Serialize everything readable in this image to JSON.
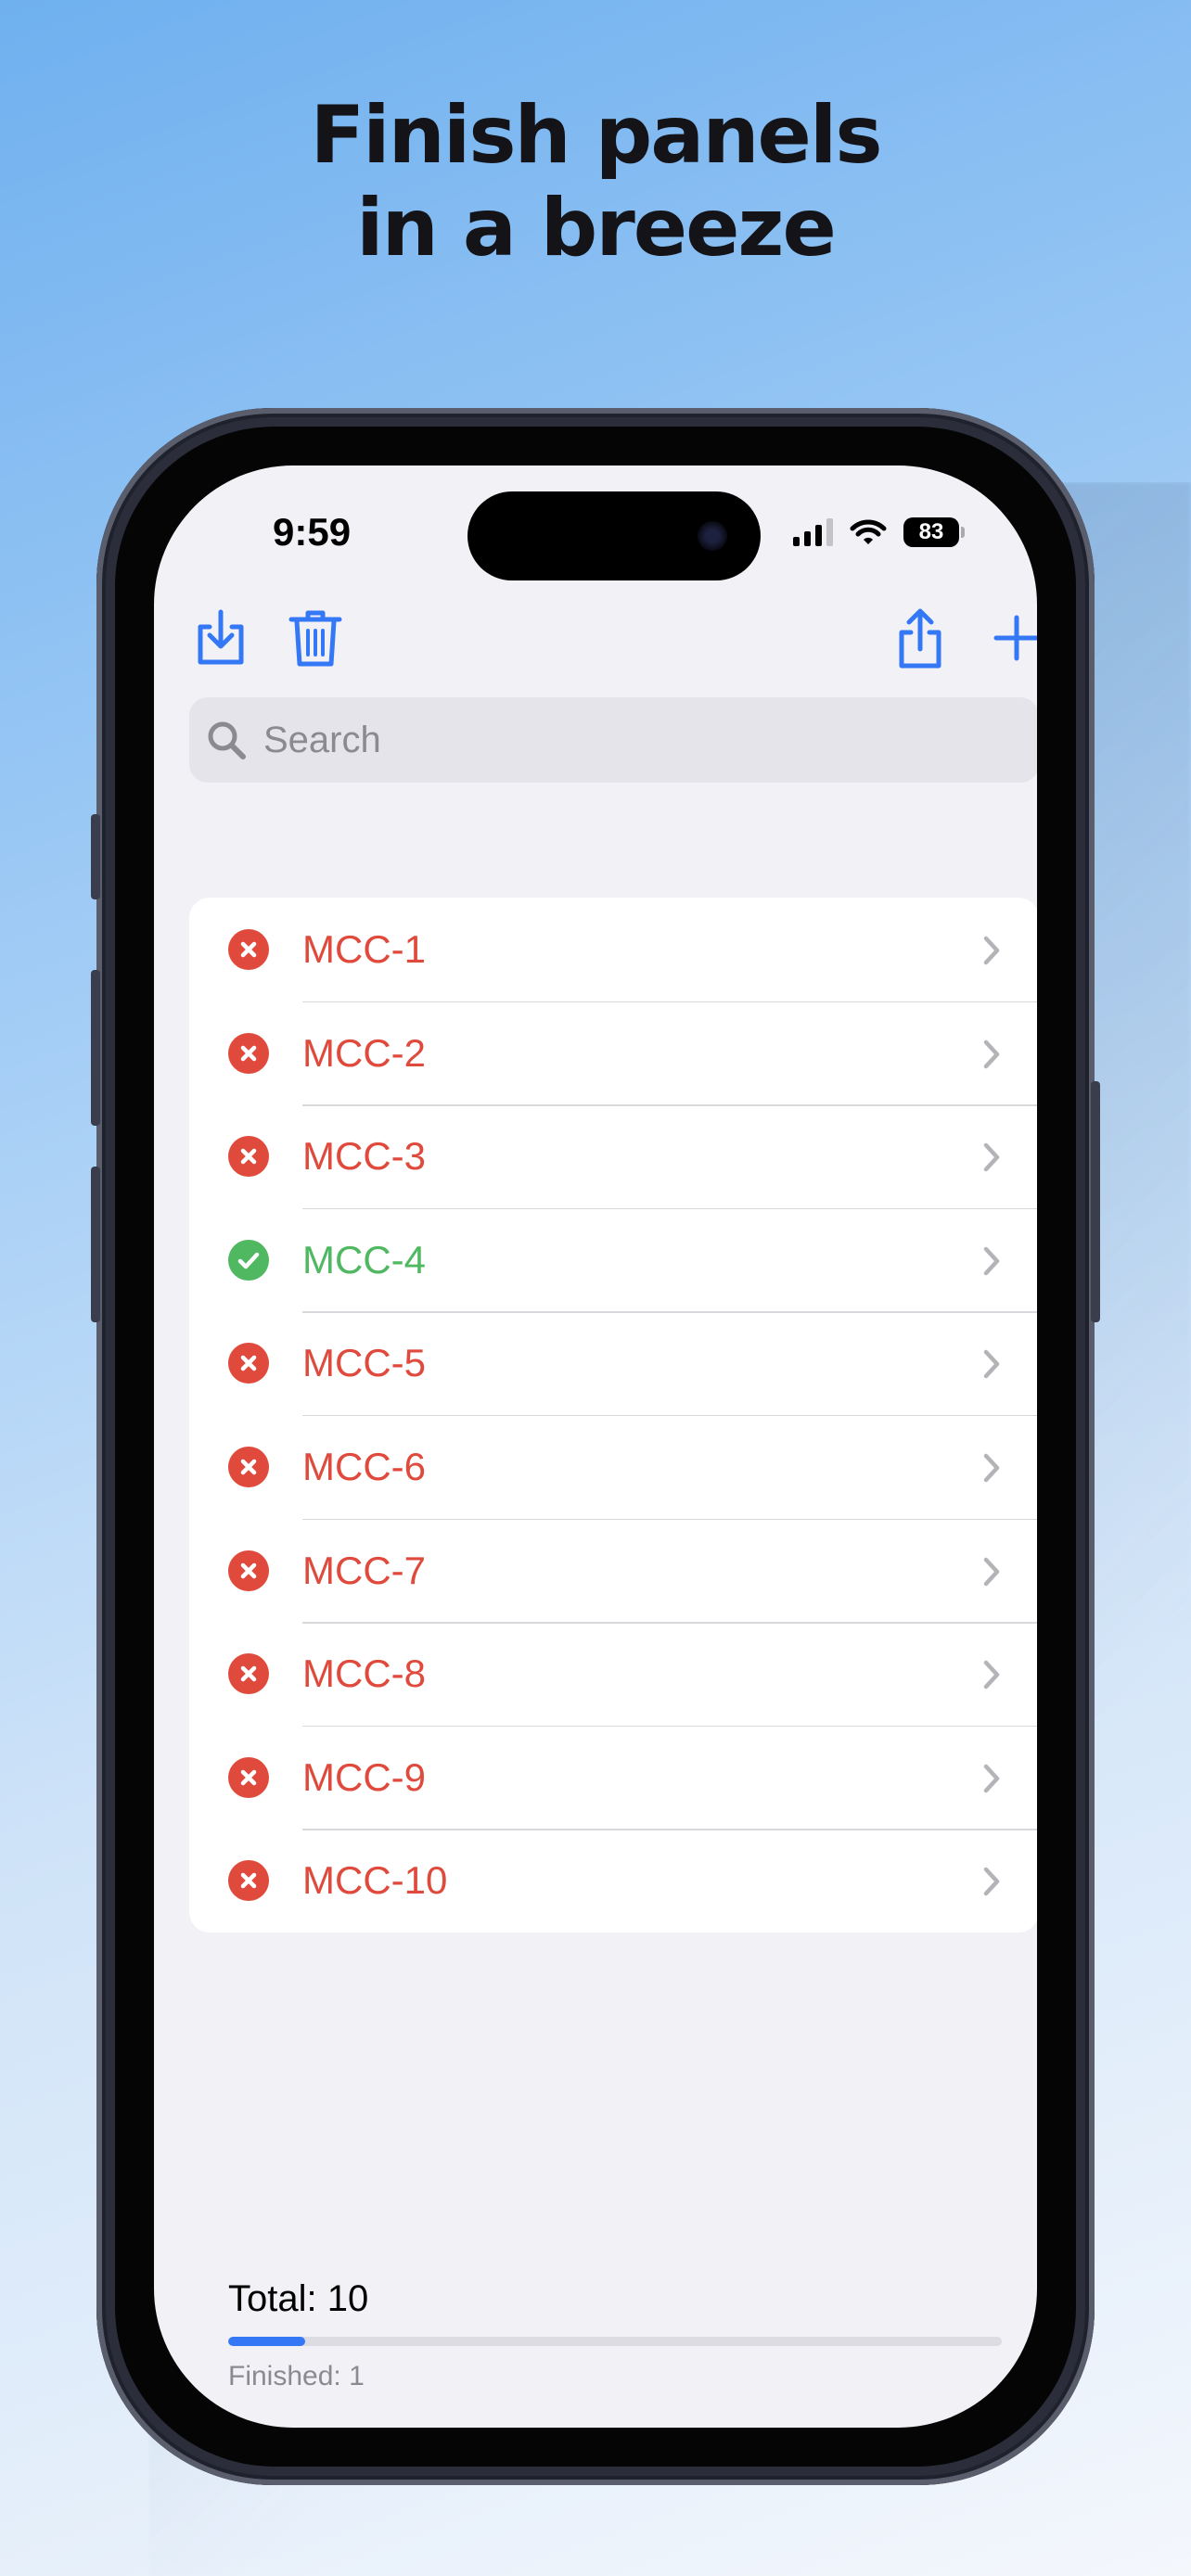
{
  "headline": {
    "line1": "Finish panels",
    "line2": "in a breeze"
  },
  "status_bar": {
    "time": "9:59",
    "battery": "83"
  },
  "toolbar": {
    "import_icon": "tray-arrow-down-icon",
    "delete_icon": "trash-icon",
    "share_icon": "share-icon",
    "add_icon": "plus-icon"
  },
  "search": {
    "placeholder": "Search"
  },
  "panels": [
    {
      "label": "MCC-1",
      "status": "unfinished"
    },
    {
      "label": "MCC-2",
      "status": "unfinished"
    },
    {
      "label": "MCC-3",
      "status": "unfinished"
    },
    {
      "label": "MCC-4",
      "status": "finished"
    },
    {
      "label": "MCC-5",
      "status": "unfinished"
    },
    {
      "label": "MCC-6",
      "status": "unfinished"
    },
    {
      "label": "MCC-7",
      "status": "unfinished"
    },
    {
      "label": "MCC-8",
      "status": "unfinished"
    },
    {
      "label": "MCC-9",
      "status": "unfinished"
    },
    {
      "label": "MCC-10",
      "status": "unfinished"
    }
  ],
  "summary": {
    "total": "Total: 10",
    "finished": "Finished: 1",
    "progress": 0.1
  },
  "colors": {
    "accent": "#3478f6",
    "unfinished": "#e04a3c",
    "finished": "#4fb861"
  }
}
